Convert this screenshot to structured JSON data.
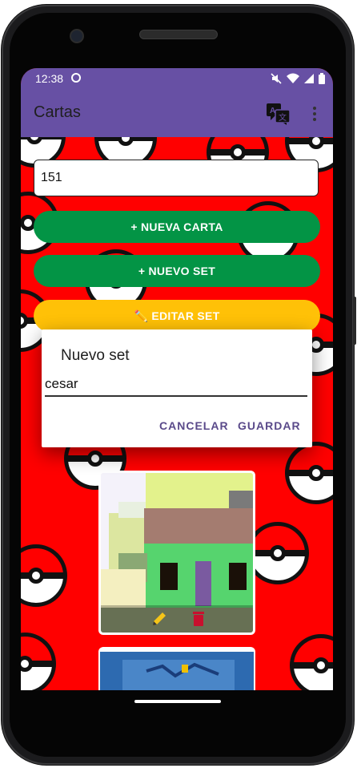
{
  "status_bar": {
    "time": "12:38"
  },
  "app_bar": {
    "title": "Cartas"
  },
  "main": {
    "search_value": "151",
    "new_card_label": "+ NUEVA CARTA",
    "new_set_label": "+ NUEVO SET",
    "edit_set_label": "✏️ EDITAR SET"
  },
  "dialog": {
    "title": "Nuevo set",
    "input_value": "cesar",
    "cancel_label": "CANCELAR",
    "save_label": "GUARDAR"
  },
  "colors": {
    "primary": "#6750a4",
    "background": "#ff0000",
    "button_green": "#039445",
    "button_yellow": "#ffc107",
    "dialog_action": "#5a4a8a"
  },
  "icons": [
    "translate-icon",
    "more-vert-icon",
    "edit-icon",
    "delete-icon",
    "wifi-icon",
    "signal-icon",
    "battery-icon",
    "mute-icon"
  ]
}
